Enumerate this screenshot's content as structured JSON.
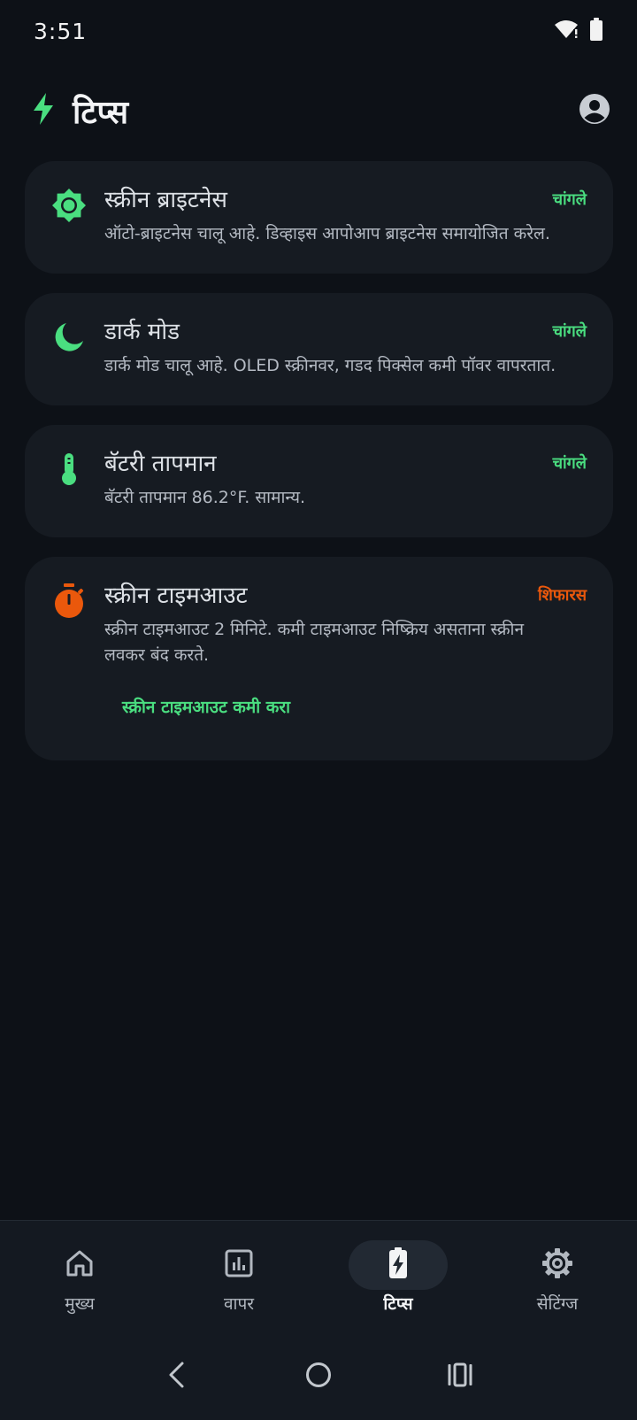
{
  "status": {
    "time": "3:51",
    "icons": [
      "wifi-icon",
      "battery-icon"
    ]
  },
  "header": {
    "title": "टिप्स",
    "icon": "bolt-icon",
    "profile_icon": "account-circle-icon"
  },
  "cards": [
    {
      "icon": "brightness-icon",
      "title": "स्क्रीन ब्राइटनेस",
      "badge": "चांगले",
      "description": "ऑटो-ब्राइटनेस चालू आहे. डिव्हाइस आपोआप ब्राइटनेस समायोजित करेल."
    },
    {
      "icon": "moon-icon",
      "title": "डार्क मोड",
      "badge": "चांगले",
      "description": "डार्क मोड चालू आहे. OLED स्क्रीनवर, गडद पिक्सेल कमी पॉवर वापरतात."
    },
    {
      "icon": "thermometer-icon",
      "title": "बॅटरी तापमान",
      "badge": "चांगले",
      "description": "बॅटरी तापमान 86.2°F. सामान्य."
    },
    {
      "icon": "timer-icon",
      "title": "स्क्रीन टाइमआउट",
      "badge": "शिफारस",
      "description": "स्क्रीन टाइमआउट 2 मिनिटे. कमी टाइमआउट निष्क्रिय असताना स्क्रीन लवकर बंद करते.",
      "action": "स्क्रीन टाइमआउट कमी करा"
    }
  ],
  "colors": {
    "accent_green": "#4ade80",
    "recommend_orange": "#ea580c",
    "background": "#0d1117",
    "card": "#161b22"
  },
  "bottom_nav": [
    {
      "label": "मुख्य",
      "icon": "home-icon"
    },
    {
      "label": "वापर",
      "icon": "usage-chart-icon"
    },
    {
      "label": "टिप्स",
      "icon": "battery-bolt-icon",
      "active": true
    },
    {
      "label": "सेटिंग्ज",
      "icon": "gear-icon"
    }
  ],
  "system_nav": [
    "back-icon",
    "home-circle-icon",
    "recents-icon"
  ]
}
